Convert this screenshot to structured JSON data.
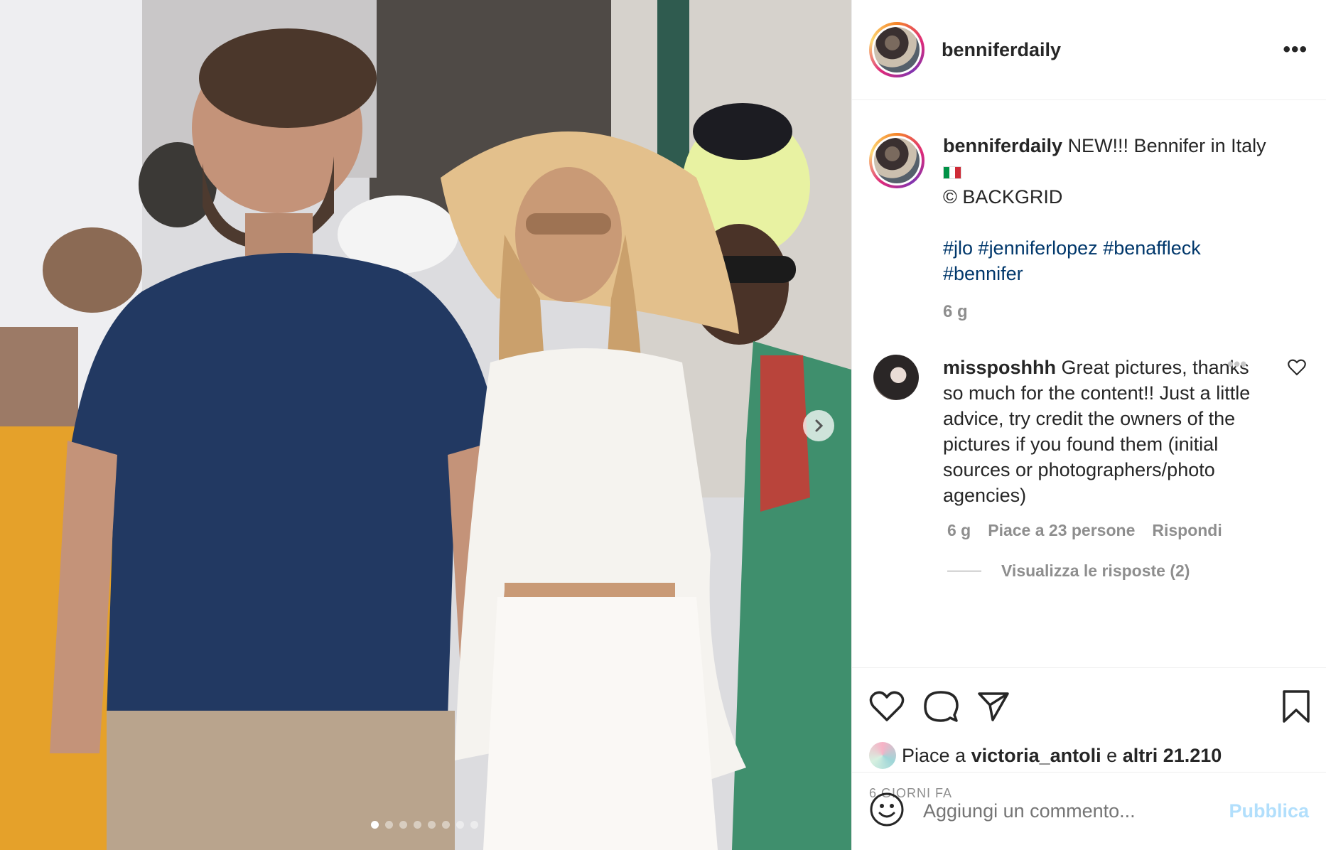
{
  "post": {
    "username": "benniferdaily",
    "more_icon": "more-horizontal-icon"
  },
  "photo": {
    "slide_count": 8,
    "active_slide": 1
  },
  "caption": {
    "username": "benniferdaily",
    "text": "NEW!!! Bennifer in Italy",
    "flag": "IT flag",
    "credit": "© BACKGRID",
    "hashtags": [
      "#jlo",
      "#jenniferlopez",
      "#benaffleck",
      "#bennifer"
    ],
    "age": "6 g"
  },
  "comment": {
    "username": "missposhhh",
    "text": "Great pictures, thanks so much for the content!! Just a little advice, try credit the owners of the pictures if you found them (initial sources or photographers/photo agencies)",
    "age": "6 g",
    "likes": "Piace a 23 persone",
    "reply": "Rispondi",
    "view_replies": "Visualizza le risposte (2)"
  },
  "likes": {
    "prefix": "Piace a",
    "user": "victoria_antoli",
    "middle": "e",
    "others": "altri 21.210"
  },
  "date": "6 GIORNI FA",
  "add_comment": {
    "placeholder": "Aggiungi un commento...",
    "publish": "Pubblica"
  }
}
